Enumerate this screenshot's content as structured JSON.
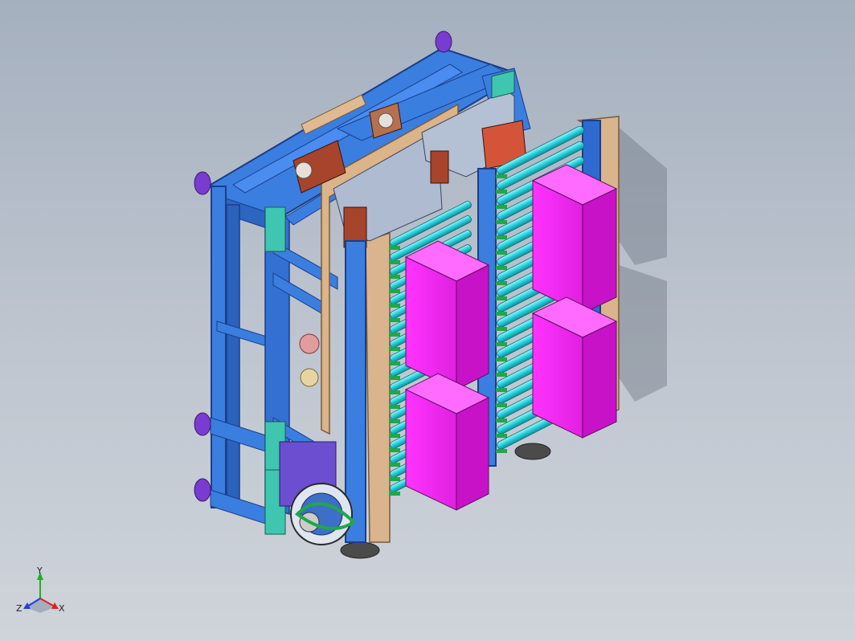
{
  "scene": {
    "description_colors": {
      "frame_blue": "#2f6fd6",
      "frame_blue_dark": "#1f4ea8",
      "roller_cyan": "#22d6e0",
      "box_magenta": "#e61ee6",
      "panel_tan": "#d9b48c",
      "plate_gray": "#a9b6c8",
      "foot_purple": "#7a3bd0",
      "teal_bracket": "#3fc6b0",
      "motor_red": "#b0482f"
    }
  },
  "triad": {
    "x_label": "X",
    "y_label": "Y",
    "z_label": "Z",
    "x_color": "#e02020",
    "y_color": "#20b020",
    "z_color": "#2040e0"
  }
}
